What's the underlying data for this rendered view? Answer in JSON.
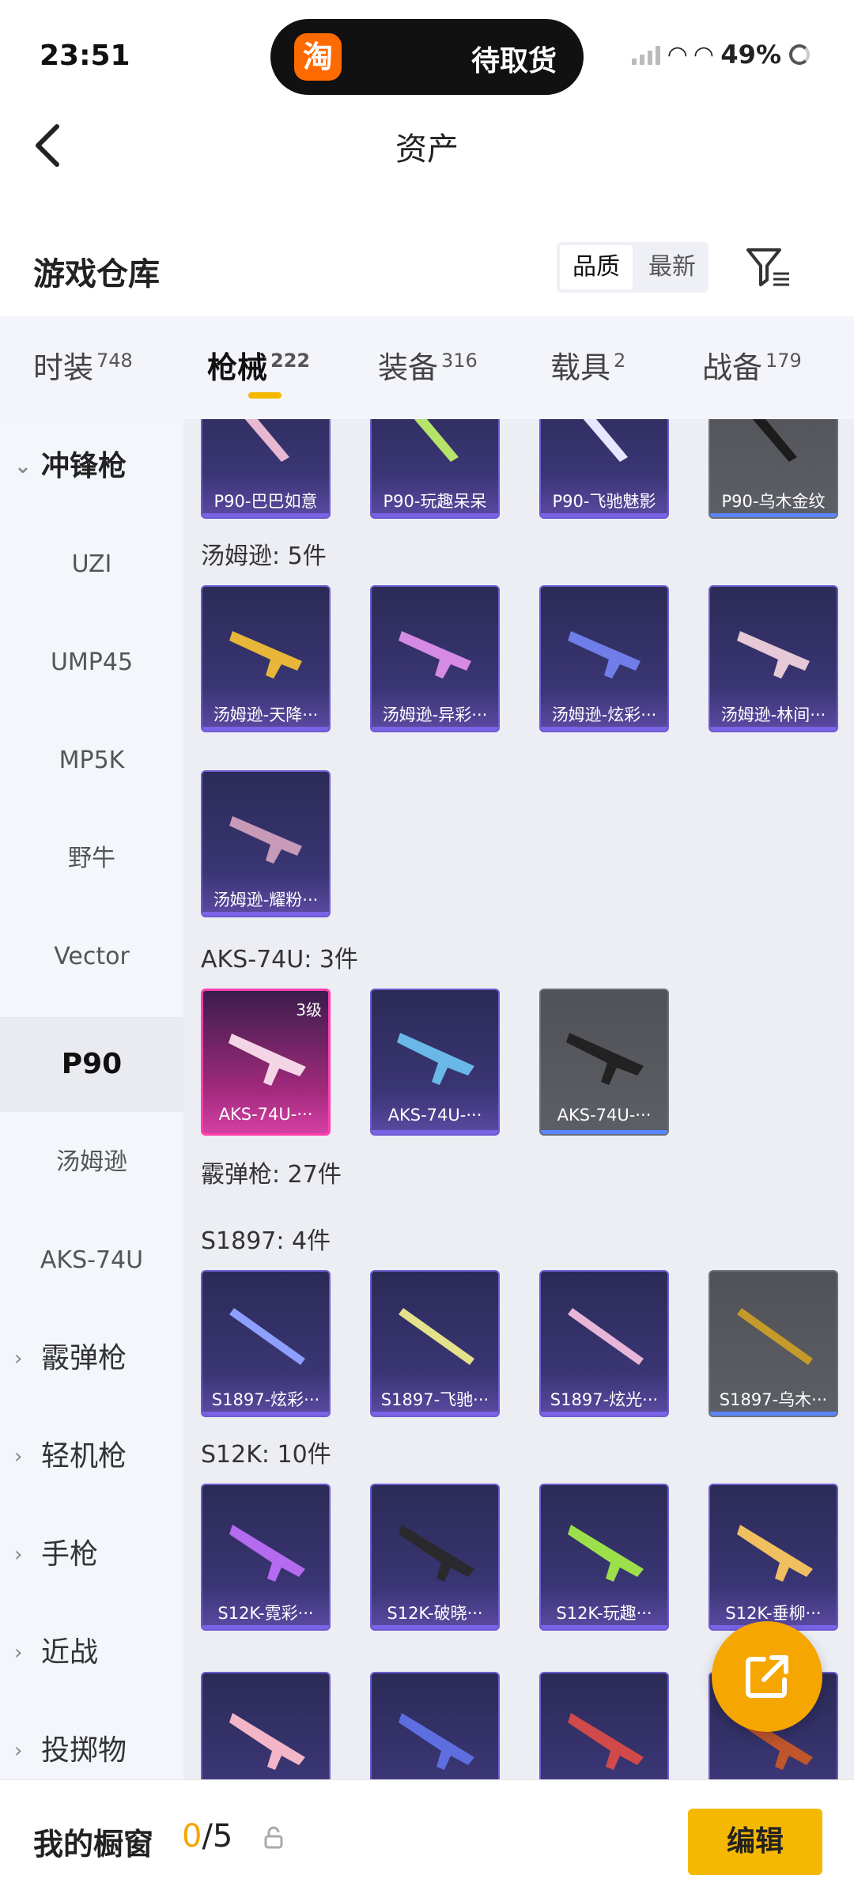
{
  "status": {
    "time": "23:51",
    "pill_text": "待取货",
    "app_icon_char": "淘",
    "battery": "49%"
  },
  "nav": {
    "title": "资产"
  },
  "warehouse": {
    "title": "游戏仓库",
    "sort_options": [
      "品质",
      "最新"
    ],
    "active_sort": "品质"
  },
  "tabs": [
    {
      "label": "时装",
      "count": "748"
    },
    {
      "label": "枪械",
      "count": "222"
    },
    {
      "label": "装备",
      "count": "316"
    },
    {
      "label": "载具",
      "count": "2"
    },
    {
      "label": "战备",
      "count": "179"
    }
  ],
  "sidebar": {
    "items": [
      "冲锋枪",
      "UZI",
      "UMP45",
      "MP5K",
      "野牛",
      "Vector",
      "P90",
      "汤姆逊",
      "AKS-74U",
      "霰弹枪",
      "轻机枪",
      "手枪",
      "近战",
      "投掷物"
    ]
  },
  "sections": {
    "p90_cards": [
      "P90-巴巴如意",
      "P90-玩趣呆呆",
      "P90-飞驰魅影",
      "P90-乌木金纹"
    ],
    "thompson_label": "汤姆逊: 5件",
    "thompson_cards": [
      "汤姆逊-天降···",
      "汤姆逊-异彩···",
      "汤姆逊-炫彩···",
      "汤姆逊-林间···",
      "汤姆逊-耀粉···"
    ],
    "aks_label": "AKS-74U: 3件",
    "aks_cards": [
      "AKS-74U-···",
      "AKS-74U-···",
      "AKS-74U-···"
    ],
    "aks_grade": "3级",
    "shotgun_label": "霰弹枪: 27件",
    "s1897_label": "S1897: 4件",
    "s1897_cards": [
      "S1897-炫彩···",
      "S1897-飞驰···",
      "S1897-炫光···",
      "S1897-乌木···"
    ],
    "s12k_label": "S12K: 10件",
    "s12k_cards": [
      "S12K-霓彩···",
      "S12K-破晓···",
      "S12K-玩趣···",
      "S12K-垂柳···"
    ]
  },
  "bottom": {
    "window_label": "我的橱窗",
    "used": "0",
    "total": "/5",
    "edit_label": "编辑"
  },
  "colors": {
    "accent": "#f5b800",
    "fab": "#f5a600",
    "card_purple": "#3a3574",
    "card_grey": "#5d5f66",
    "card_pink": "#d440a4"
  }
}
